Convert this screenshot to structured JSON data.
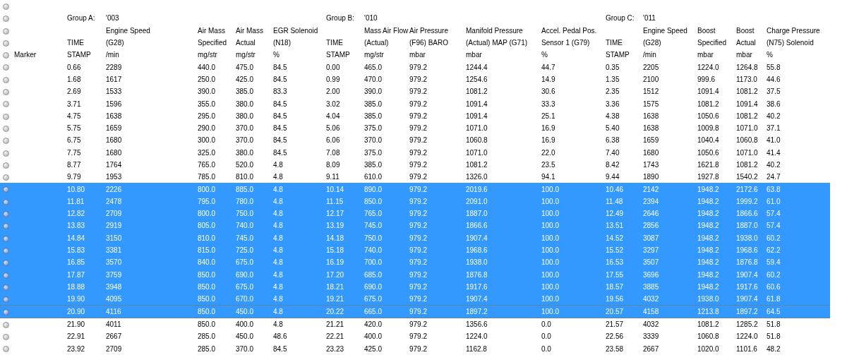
{
  "marker_label": "Marker",
  "groups": [
    {
      "label": "Group A:",
      "code": "'003",
      "columns": [
        {
          "lines": [
            "TIME",
            "STAMP"
          ]
        },
        {
          "lines": [
            "Engine Speed",
            "(G28)",
            "/min"
          ]
        },
        {
          "lines": [
            "Air Mass",
            "Specified",
            "mg/str"
          ]
        },
        {
          "lines": [
            "Air Mass",
            "Actual",
            "mg/str"
          ]
        },
        {
          "lines": [
            "EGR Solenoid",
            "(N18)",
            "%"
          ]
        }
      ]
    },
    {
      "label": "Group B:",
      "code": "'010",
      "columns": [
        {
          "lines": [
            "TIME",
            "STAMP"
          ]
        },
        {
          "lines": [
            "Mass Air Flow",
            "(Actual)",
            "mg/str"
          ]
        },
        {
          "lines": [
            "Air Pressure",
            "(F96) BARO",
            "mbar"
          ]
        },
        {
          "lines": [
            "Manifold Pressure",
            "(Actual) MAP (G71)",
            "mbar"
          ]
        },
        {
          "lines": [
            "Accel. Pedal Pos.",
            "Sensor 1 (G79)",
            "%"
          ]
        }
      ]
    },
    {
      "label": "Group C:",
      "code": "'011",
      "columns": [
        {
          "lines": [
            "TIME",
            "STAMP"
          ]
        },
        {
          "lines": [
            "Engine Speed",
            "(G28)",
            "/min"
          ]
        },
        {
          "lines": [
            "Boost",
            "Specified",
            "mbar"
          ]
        },
        {
          "lines": [
            "Boost",
            "Actual",
            "mbar"
          ]
        },
        {
          "lines": [
            "Charge Pressure",
            "(N75) Solenoid",
            "%"
          ]
        }
      ]
    }
  ],
  "rows": [
    {
      "selected": false,
      "focused": false,
      "cells": [
        "0.66",
        "2289",
        "440.0",
        "475.0",
        "84.5",
        "0.00",
        "465.0",
        "979.2",
        "1244.4",
        "44.7",
        "0.35",
        "2205",
        "1224.0",
        "1264.8",
        "55.8"
      ]
    },
    {
      "selected": false,
      "focused": false,
      "cells": [
        "1.68",
        "1617",
        "250.0",
        "425.0",
        "84.5",
        "0.99",
        "470.0",
        "979.2",
        "1254.6",
        "14.9",
        "1.35",
        "2100",
        "999.6",
        "1173.0",
        "44.6"
      ]
    },
    {
      "selected": false,
      "focused": false,
      "cells": [
        "2.69",
        "1533",
        "390.0",
        "385.0",
        "83.3",
        "2.00",
        "390.0",
        "979.2",
        "1081.2",
        "30.6",
        "2.35",
        "1512",
        "1091.4",
        "1081.2",
        "37.5"
      ]
    },
    {
      "selected": false,
      "focused": false,
      "cells": [
        "3.71",
        "1596",
        "355.0",
        "380.0",
        "84.5",
        "3.02",
        "385.0",
        "979.2",
        "1091.4",
        "33.3",
        "3.36",
        "1575",
        "1081.2",
        "1091.4",
        "38.6"
      ]
    },
    {
      "selected": false,
      "focused": false,
      "cells": [
        "4.75",
        "1638",
        "295.0",
        "380.0",
        "84.5",
        "4.04",
        "385.0",
        "979.2",
        "1091.4",
        "25.1",
        "4.38",
        "1638",
        "1050.6",
        "1081.2",
        "40.2"
      ]
    },
    {
      "selected": false,
      "focused": false,
      "cells": [
        "5.75",
        "1659",
        "290.0",
        "370.0",
        "84.5",
        "5.06",
        "375.0",
        "979.2",
        "1071.0",
        "16.9",
        "5.40",
        "1638",
        "1009.8",
        "1071.0",
        "37.1"
      ]
    },
    {
      "selected": false,
      "focused": false,
      "cells": [
        "6.75",
        "1680",
        "300.0",
        "370.0",
        "84.5",
        "6.06",
        "370.0",
        "979.2",
        "1060.8",
        "16.9",
        "6.38",
        "1659",
        "1040.4",
        "1060.8",
        "41.0"
      ]
    },
    {
      "selected": false,
      "focused": false,
      "cells": [
        "7.75",
        "1680",
        "325.0",
        "380.0",
        "84.5",
        "7.08",
        "375.0",
        "979.2",
        "1071.0",
        "22.0",
        "7.40",
        "1680",
        "1050.6",
        "1071.0",
        "41.4"
      ]
    },
    {
      "selected": false,
      "focused": false,
      "cells": [
        "8.77",
        "1764",
        "765.0",
        "520.0",
        "4.8",
        "8.09",
        "385.0",
        "979.2",
        "1081.2",
        "23.5",
        "8.42",
        "1743",
        "1621.8",
        "1081.2",
        "40.2"
      ]
    },
    {
      "selected": false,
      "focused": false,
      "cells": [
        "9.79",
        "1953",
        "785.0",
        "810.0",
        "4.8",
        "9.11",
        "610.0",
        "979.2",
        "1326.0",
        "94.1",
        "9.44",
        "1890",
        "1927.8",
        "1540.2",
        "24.7"
      ]
    },
    {
      "selected": true,
      "focused": false,
      "cells": [
        "10.80",
        "2226",
        "800.0",
        "885.0",
        "4.8",
        "10.14",
        "890.0",
        "979.2",
        "2019.6",
        "100.0",
        "10.46",
        "2142",
        "1948.2",
        "2172.6",
        "63.8"
      ]
    },
    {
      "selected": true,
      "focused": false,
      "cells": [
        "11.81",
        "2478",
        "795.0",
        "780.0",
        "4.8",
        "11.15",
        "850.0",
        "979.2",
        "2091.0",
        "100.0",
        "11.48",
        "2394",
        "1948.2",
        "1999.2",
        "61.0"
      ]
    },
    {
      "selected": true,
      "focused": false,
      "cells": [
        "12.82",
        "2709",
        "800.0",
        "750.0",
        "4.8",
        "12.17",
        "765.0",
        "979.2",
        "1887.0",
        "100.0",
        "12.49",
        "2646",
        "1948.2",
        "1866.6",
        "57.4"
      ]
    },
    {
      "selected": true,
      "focused": false,
      "cells": [
        "13.83",
        "2919",
        "805.0",
        "740.0",
        "4.8",
        "13.19",
        "745.0",
        "979.2",
        "1866.6",
        "100.0",
        "13.51",
        "2856",
        "1948.2",
        "1887.0",
        "57.4"
      ]
    },
    {
      "selected": true,
      "focused": false,
      "cells": [
        "14.84",
        "3150",
        "810.0",
        "745.0",
        "4.8",
        "14.18",
        "750.0",
        "979.2",
        "1907.4",
        "100.0",
        "14.52",
        "3087",
        "1948.2",
        "1938.0",
        "60.2"
      ]
    },
    {
      "selected": true,
      "focused": false,
      "cells": [
        "15.83",
        "3381",
        "815.0",
        "725.0",
        "4.8",
        "15.18",
        "740.0",
        "979.2",
        "1968.6",
        "100.0",
        "15.52",
        "3297",
        "1948.2",
        "1968.6",
        "62.2"
      ]
    },
    {
      "selected": true,
      "focused": false,
      "cells": [
        "16.85",
        "3570",
        "840.0",
        "675.0",
        "4.8",
        "16.19",
        "700.0",
        "979.2",
        "1938.0",
        "100.0",
        "16.53",
        "3507",
        "1948.2",
        "1876.8",
        "59.4"
      ]
    },
    {
      "selected": true,
      "focused": false,
      "cells": [
        "17.87",
        "3759",
        "850.0",
        "690.0",
        "4.8",
        "17.20",
        "685.0",
        "979.2",
        "1876.8",
        "100.0",
        "17.55",
        "3696",
        "1948.2",
        "1907.4",
        "60.2"
      ]
    },
    {
      "selected": true,
      "focused": false,
      "cells": [
        "18.88",
        "3948",
        "850.0",
        "675.0",
        "4.8",
        "18.21",
        "690.0",
        "979.2",
        "1917.6",
        "100.0",
        "18.57",
        "3885",
        "1948.2",
        "1917.6",
        "60.6"
      ]
    },
    {
      "selected": true,
      "focused": false,
      "cells": [
        "19.90",
        "4095",
        "850.0",
        "670.0",
        "4.8",
        "19.21",
        "675.0",
        "979.2",
        "1907.4",
        "100.0",
        "19.56",
        "4032",
        "1938.0",
        "1907.4",
        "61.8"
      ]
    },
    {
      "selected": true,
      "focused": true,
      "cells": [
        "20.90",
        "4116",
        "850.0",
        "450.0",
        "4.8",
        "20.22",
        "665.0",
        "979.2",
        "1897.2",
        "100.0",
        "20.57",
        "4158",
        "1213.8",
        "1897.2",
        "64.5"
      ]
    },
    {
      "selected": false,
      "focused": false,
      "cells": [
        "21.90",
        "4011",
        "850.0",
        "400.0",
        "4.8",
        "21.21",
        "420.0",
        "979.2",
        "1356.6",
        "0.0",
        "21.57",
        "4032",
        "1081.2",
        "1285.2",
        "51.8"
      ]
    },
    {
      "selected": false,
      "focused": false,
      "cells": [
        "22.91",
        "2667",
        "285.0",
        "450.0",
        "48.6",
        "22.21",
        "400.0",
        "979.2",
        "1224.0",
        "0.0",
        "22.56",
        "3339",
        "1060.8",
        "1224.0",
        "51.8"
      ]
    },
    {
      "selected": false,
      "focused": false,
      "cells": [
        "23.92",
        "2709",
        "285.0",
        "370.0",
        "84.5",
        "23.23",
        "425.0",
        "979.2",
        "1162.8",
        "0.0",
        "23.58",
        "2667",
        "1020.0",
        "1101.6",
        "48.2"
      ]
    }
  ]
}
